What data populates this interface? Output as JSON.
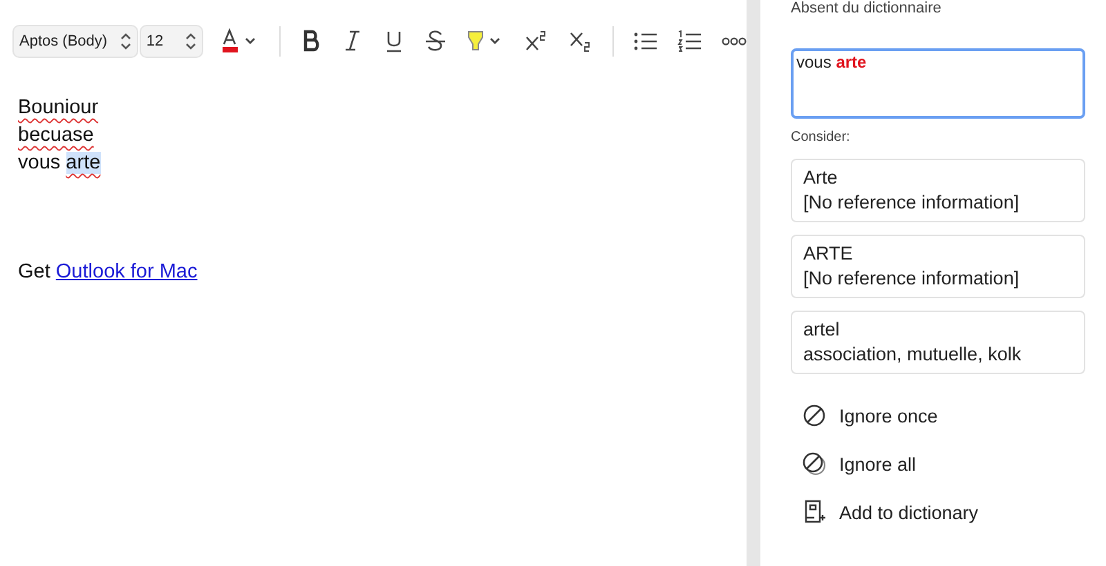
{
  "toolbar": {
    "font": "Aptos (Body)",
    "size": "12"
  },
  "editor": {
    "lines": [
      [
        {
          "text": "Bouniour",
          "misspelled": true,
          "selected": false
        }
      ],
      [
        {
          "text": "becuase",
          "misspelled": true,
          "selected": false
        }
      ],
      [
        {
          "text": "vous ",
          "misspelled": false,
          "selected": false
        },
        {
          "text": "arte",
          "misspelled": true,
          "selected": true
        }
      ]
    ],
    "signature": {
      "text": "Get ",
      "link": "Outlook for Mac"
    }
  },
  "panel": {
    "heading": "Absent du dictionnaire",
    "context": [
      {
        "text": "vous ",
        "error": false
      },
      {
        "text": "arte",
        "error": true
      }
    ],
    "consider_label": "Consider:",
    "suggestions": [
      {
        "word": "Arte",
        "detail": "[No reference information]"
      },
      {
        "word": "ARTE",
        "detail": "[No reference information]"
      },
      {
        "word": "artel",
        "detail": "association, mutuelle, kolk"
      }
    ],
    "actions": [
      {
        "kind": "ignore-once",
        "label": "Ignore once"
      },
      {
        "kind": "ignore-all",
        "label": "Ignore all"
      },
      {
        "kind": "add",
        "label": "Add to dictionary"
      }
    ]
  }
}
